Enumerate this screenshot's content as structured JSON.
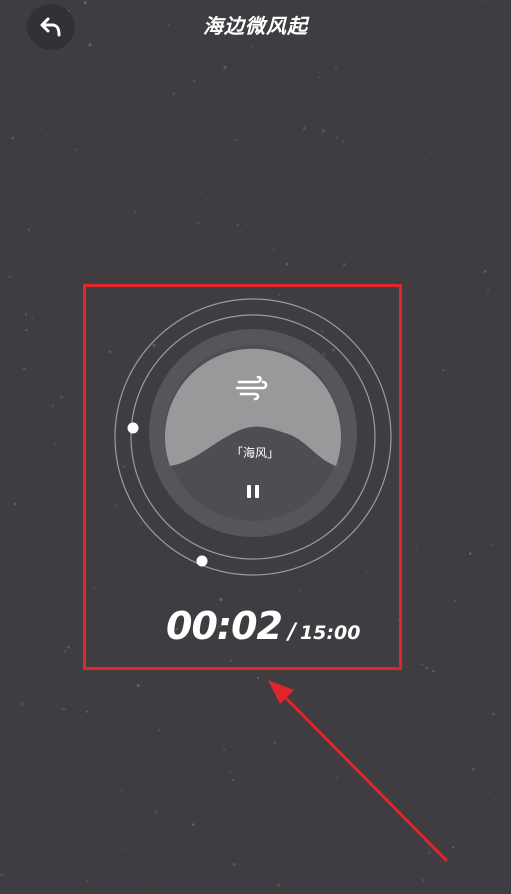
{
  "header": {
    "back_icon": "back-arrow-icon",
    "title": "海边微风起"
  },
  "player": {
    "sound_icon": "wind-icon",
    "sound_label": "「海风」",
    "control_icon": "pause-icon",
    "elapsed": "00:02",
    "separator": "/",
    "total": "15:00"
  },
  "colors": {
    "background": "#3f3d41",
    "highlight_box": "#e0262a",
    "dome": "#9a989b",
    "knob": "#ffffff"
  }
}
